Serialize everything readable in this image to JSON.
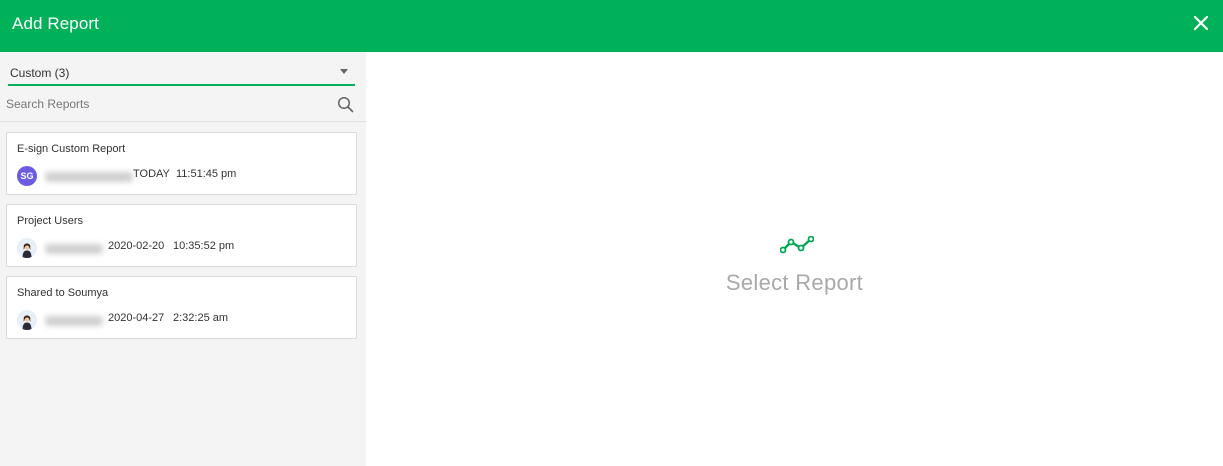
{
  "header": {
    "title": "Add Report",
    "close_icon": "close-icon"
  },
  "sidebar": {
    "filter": {
      "selected": "Custom (3)",
      "caret_icon": "chevron-down-icon"
    },
    "search": {
      "placeholder": "Search Reports",
      "value": "",
      "icon": "search-icon"
    },
    "reports": [
      {
        "name": "E-sign Custom Report",
        "avatar": "SG",
        "date": "TODAY",
        "time": "11:51:45 pm"
      },
      {
        "name": "Project Users",
        "avatar": "user-photo",
        "date": "2020-02-20",
        "time": "10:35:52 pm"
      },
      {
        "name": "Shared to Soumya",
        "avatar": "user-photo",
        "date": "2020-04-27",
        "time": "2:32:25 am"
      }
    ]
  },
  "main": {
    "empty_icon": "line-chart-icon",
    "empty_text": "Select Report"
  },
  "colors": {
    "brand": "#00b159",
    "avatar_initials_bg": "#6b5ce0",
    "sidebar_bg": "#f4f4f4"
  }
}
